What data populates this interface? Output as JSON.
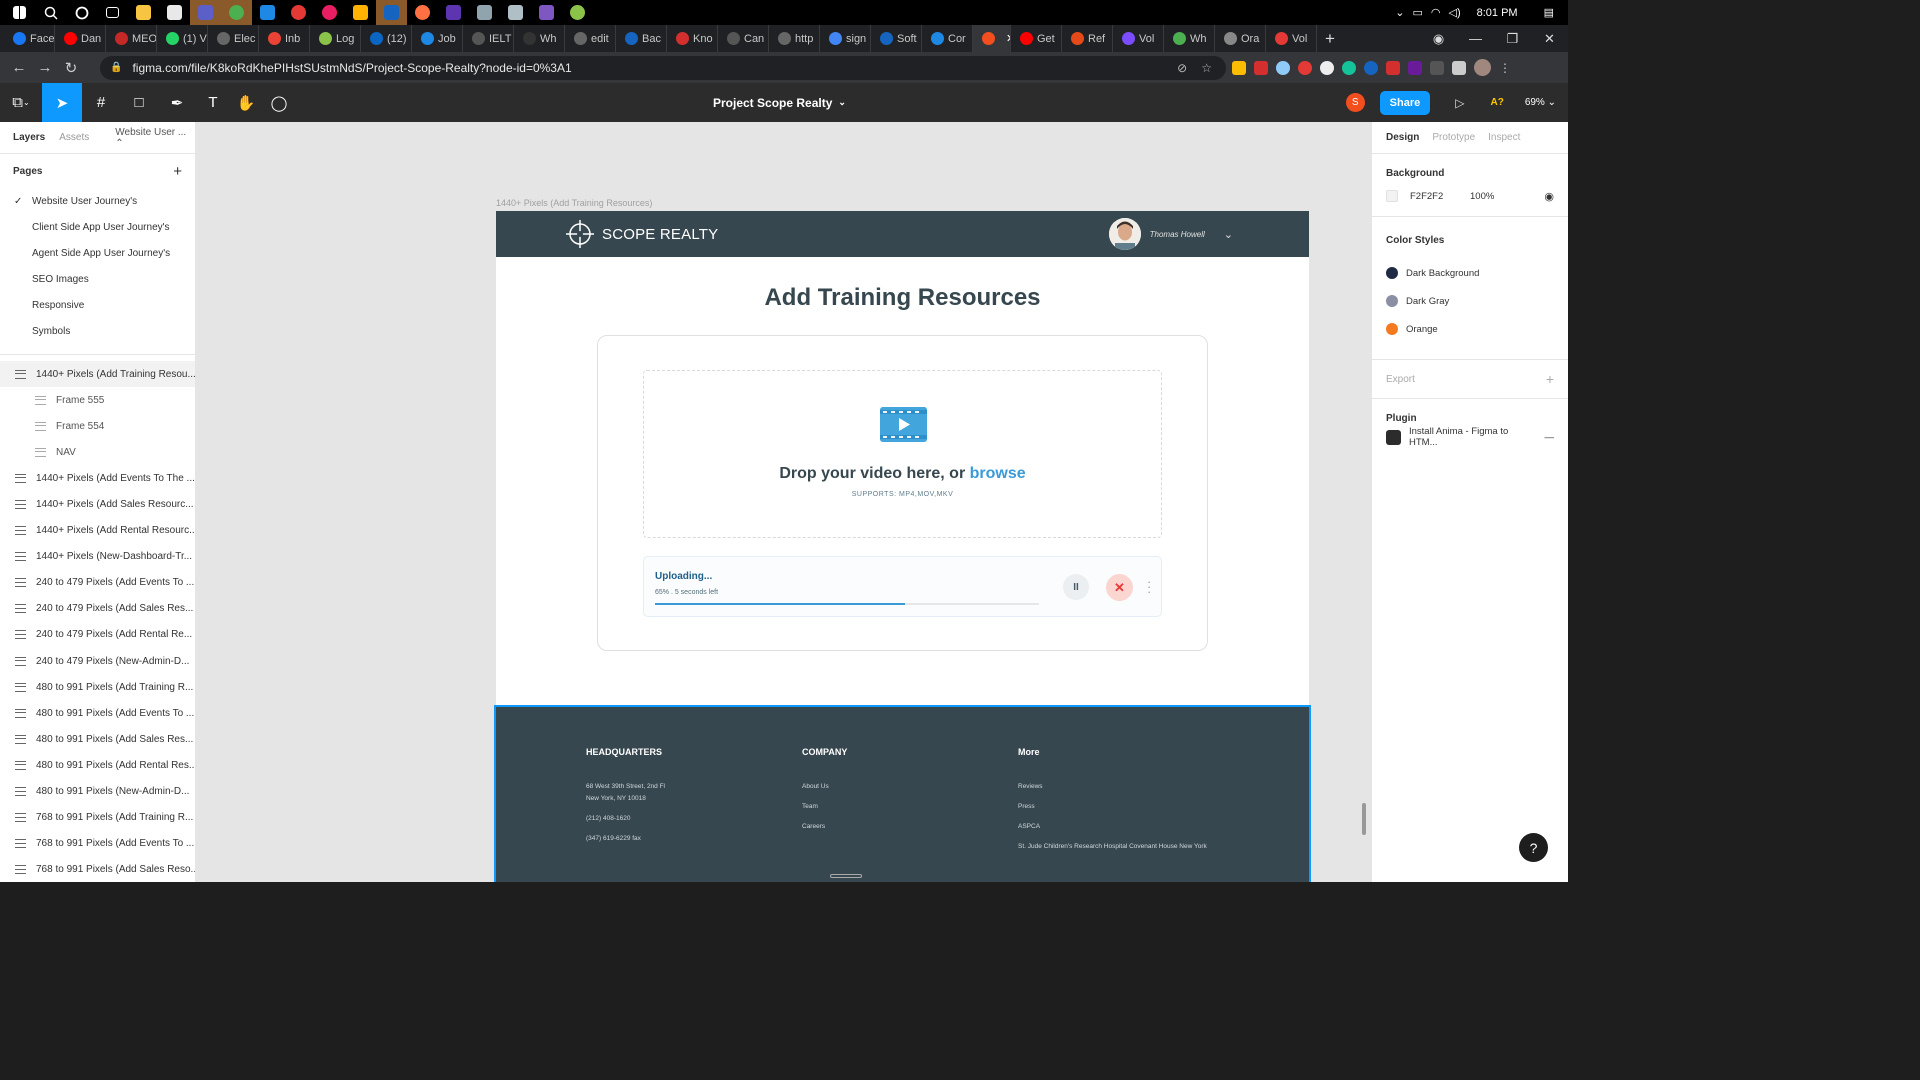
{
  "taskbar": {
    "time": "8:01 PM"
  },
  "browser_tabs": [
    "Face",
    "Dan",
    "MEO",
    "(1) V",
    "Elec",
    "Inb",
    "Log",
    "(12)",
    "Job",
    "IELT",
    "Wh",
    "edit",
    "Bac",
    "Kno",
    "Can",
    "http",
    "sign",
    "Soft",
    "Cor",
    "",
    "Get",
    "Ref",
    "Vol",
    "Wh",
    "Ora",
    "Vol"
  ],
  "active_tab_index": 19,
  "address": {
    "url": "figma.com/file/K8koRdKhePIHstSUstmNdS/Project-Scope-Realty?node-id=0%3A1"
  },
  "figma": {
    "file_title": "Project Scope Realty",
    "avatar_letter": "S",
    "share_label": "Share",
    "a_label": "A?",
    "zoom": "69%"
  },
  "left_panel": {
    "tabs": [
      "Layers",
      "Assets",
      "Website User ..."
    ],
    "pages_heading": "Pages",
    "pages": [
      "Website User Journey's",
      "Client Side App User Journey's",
      "Agent Side App User Journey's",
      "SEO Images",
      "Responsive",
      "Symbols"
    ],
    "layers": [
      {
        "label": "1440+ Pixels (Add Training Resou...",
        "child": false
      },
      {
        "label": "Frame 555",
        "child": true
      },
      {
        "label": "Frame 554",
        "child": true
      },
      {
        "label": "NAV",
        "child": true
      },
      {
        "label": "1440+ Pixels (Add Events To The ...",
        "child": false
      },
      {
        "label": "1440+ Pixels (Add Sales Resourc...",
        "child": false
      },
      {
        "label": "1440+ Pixels (Add Rental Resourc...",
        "child": false
      },
      {
        "label": "1440+ Pixels (New-Dashboard-Tr...",
        "child": false
      },
      {
        "label": "240 to 479 Pixels (Add Events To ...",
        "child": false
      },
      {
        "label": "240 to 479 Pixels  (Add Sales Res...",
        "child": false
      },
      {
        "label": "240 to 479 Pixels  (Add Rental Re...",
        "child": false
      },
      {
        "label": "240 to 479 Pixels (New-Admin-D...",
        "child": false
      },
      {
        "label": "480 to 991 Pixels (Add Training R...",
        "child": false
      },
      {
        "label": "480 to 991 Pixels (Add Events To ...",
        "child": false
      },
      {
        "label": "480 to 991 Pixels  (Add Sales Res...",
        "child": false
      },
      {
        "label": "480 to 991 Pixels (Add Rental Res...",
        "child": false
      },
      {
        "label": "480 to 991 Pixels (New-Admin-D...",
        "child": false
      },
      {
        "label": "768 to 991 Pixels (Add Training R...",
        "child": false
      },
      {
        "label": "768 to 991 Pixels  (Add Events To ...",
        "child": false
      },
      {
        "label": "768 to 991 Pixels (Add Sales Reso...",
        "child": false
      }
    ]
  },
  "canvas": {
    "frame_label": "1440+ Pixels (Add Training Resources)",
    "site": {
      "logo_text": "SCOPE REALTY",
      "user_name": "Thomas Howell",
      "page_title": "Add Training Resources",
      "drop_text": "Drop your video here, or ",
      "browse": "browse",
      "supports": "SUPPORTS: MP4,MOV,MKV",
      "upload_title": "Uploading...",
      "upload_sub": "65% . 5 seconds left",
      "upload_progress": 0.65,
      "footer": {
        "hq_title": "HEADQUARTERS",
        "hq_lines": [
          "68 West 39th Street, 2nd Fl",
          "New York, NY 10018",
          "(212) 408-1620",
          "(347) 619-6229 fax"
        ],
        "company_title": "COMPANY",
        "company_links": [
          "About Us",
          "Team",
          "Careers"
        ],
        "more_title": "More",
        "more_links": [
          "Reviews",
          "Press",
          "ASPCA",
          "St. Jude Children's Research Hospital Covenant House New York"
        ]
      }
    }
  },
  "right_panel": {
    "tabs": [
      "Design",
      "Prototype",
      "Inspect"
    ],
    "background_heading": "Background",
    "background_hex": "F2F2F2",
    "background_opacity": "100%",
    "color_styles_heading": "Color Styles",
    "color_styles": [
      {
        "name": "Dark Background",
        "color": "#1f2a44"
      },
      {
        "name": "Dark Gray",
        "color": "#8a8fa3"
      },
      {
        "name": "Orange",
        "color": "#f47a20"
      }
    ],
    "export_heading": "Export",
    "plugin_heading": "Plugin",
    "plugin_item": "Install Anima - Figma to HTM..."
  }
}
